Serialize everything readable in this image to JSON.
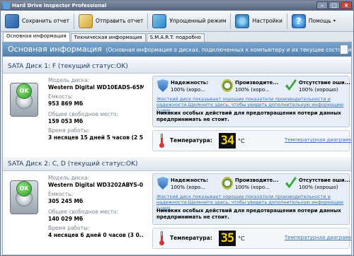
{
  "window": {
    "title": "Hard Drive Inspector Professional"
  },
  "toolbar": {
    "save": "Сохранить отчет",
    "send": "Отправить отчет",
    "mode": "Упрощенный режим",
    "settings": "Настройки",
    "help": "Помощь"
  },
  "tabs": [
    "Основная информация",
    "Техническая информация",
    "S.M.A.R.T. подробно"
  ],
  "header": {
    "title": "Основная информация",
    "subtitle": "(Основная информация о дисках, подключенных к компьютеру и  их текущее состояние)"
  },
  "labels": {
    "model": "Модель диска:",
    "capacity": "Емкость:",
    "free": "Общее свободное место:",
    "uptime": "Время работы:",
    "reliability": "Надежность:",
    "performance": "Производите...",
    "errors": "Отсутствие оши...",
    "temperature": "Температура:",
    "temp_link": "Температурная диаграмма",
    "ok": "OK"
  },
  "disks": [
    {
      "heading": "SATA Диск 1: F (текущий статус:OK)",
      "model": "Western Digital WD10EADS-65M...",
      "capacity": "953 869 Мб",
      "free": "159 053 Мб",
      "uptime": "3 несяцев 15 дней 5 часов (2 5...",
      "reliability_value": "100% (хоро...",
      "performance_value": "100% (хоро...",
      "errors_value": "100% (хорошо)",
      "description": "Жесткий диск показывает хорошие показатели производительности и надежности.Щелкните здесь, чтобы увидеть дополнительную информацию о нем.",
      "note": "Никаких особых действий для предотвращения потери данных предпринимать не стоит.",
      "temperature": "34",
      "temp_unit": "°C"
    },
    {
      "heading": "SATA Диск 2: C, D (текущий статус:OK)",
      "model": "Western Digital WD3202ABYS-0...",
      "capacity": "305 245 Мб",
      "free": "140 029 Мб",
      "uptime": "4 несяцев 6 дней 0 часов (3 0...",
      "reliability_value": "100% (хоро...",
      "performance_value": "100% (хоро...",
      "errors_value": "100% (хорошо)",
      "description": "Жесткий диск показывает хорошие показатели производительности и надежности.Щелкните здесь, чтобы увидеть дополнительную информацию о нем.",
      "note": "Никаких особых действий для предотвращения потери данных предпринимать не стоит.",
      "temperature": "35",
      "temp_unit": "°C"
    }
  ]
}
